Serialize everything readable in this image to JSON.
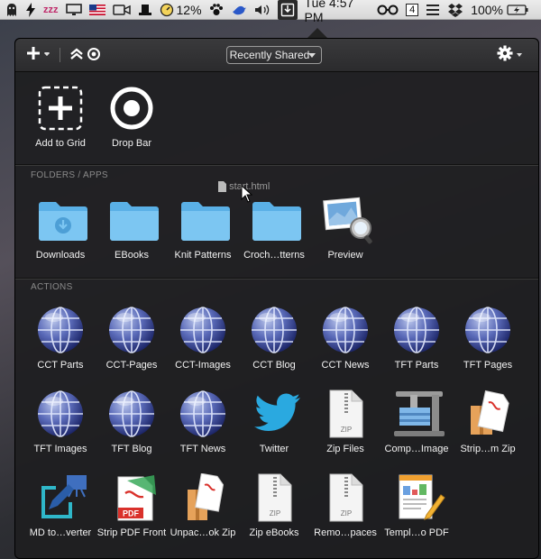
{
  "menubar": {
    "battery_percent": "12%",
    "clock": "Tue 4:57 PM",
    "notification_count": "4",
    "battery_main": "100%"
  },
  "toolbar": {
    "dropdown_label": "Recently Shared"
  },
  "top_items": [
    {
      "label": "Add to Grid",
      "icon": "add-icon"
    },
    {
      "label": "Drop Bar",
      "icon": "target-icon"
    }
  ],
  "folders_section": {
    "title": "FOLDERS / APPS",
    "items": [
      {
        "label": "Downloads",
        "icon": "downloads-folder-icon"
      },
      {
        "label": "EBooks",
        "icon": "folder-icon"
      },
      {
        "label": "Knit Patterns",
        "icon": "folder-icon"
      },
      {
        "label": "Croch…tterns",
        "icon": "folder-icon"
      },
      {
        "label": "Preview",
        "icon": "preview-app-icon"
      }
    ]
  },
  "drag_file": "start.html",
  "actions_section": {
    "title": "ACTIONS",
    "rows": [
      [
        {
          "label": "CCT Parts",
          "icon": "globe-icon"
        },
        {
          "label": "CCT-Pages",
          "icon": "globe-icon"
        },
        {
          "label": "CCT-Images",
          "icon": "globe-icon"
        },
        {
          "label": "CCT Blog",
          "icon": "globe-icon"
        },
        {
          "label": "CCT News",
          "icon": "globe-icon"
        },
        {
          "label": "TFT Parts",
          "icon": "globe-icon"
        },
        {
          "label": "TFT Pages",
          "icon": "globe-icon"
        }
      ],
      [
        {
          "label": "TFT Images",
          "icon": "globe-icon"
        },
        {
          "label": "TFT Blog",
          "icon": "globe-icon"
        },
        {
          "label": "TFT News",
          "icon": "globe-icon"
        },
        {
          "label": "Twitter",
          "icon": "twitter-icon"
        },
        {
          "label": "Zip Files",
          "icon": "zip-icon"
        },
        {
          "label": "Comp…Image",
          "icon": "compress-icon"
        },
        {
          "label": "Strip…m Zip",
          "icon": "strip-zip-icon"
        }
      ],
      [
        {
          "label": "MD to…verter",
          "icon": "md-converter-icon"
        },
        {
          "label": "Strip PDF Front",
          "icon": "pdf-icon"
        },
        {
          "label": "Unpac…ok Zip",
          "icon": "unpack-zip-icon"
        },
        {
          "label": "Zip eBooks",
          "icon": "zip-icon"
        },
        {
          "label": "Remo…paces",
          "icon": "zip-icon"
        },
        {
          "label": "Templ…o PDF",
          "icon": "template-pdf-icon"
        }
      ]
    ]
  },
  "zip_text": "ZIP",
  "pdf_text": "PDF"
}
